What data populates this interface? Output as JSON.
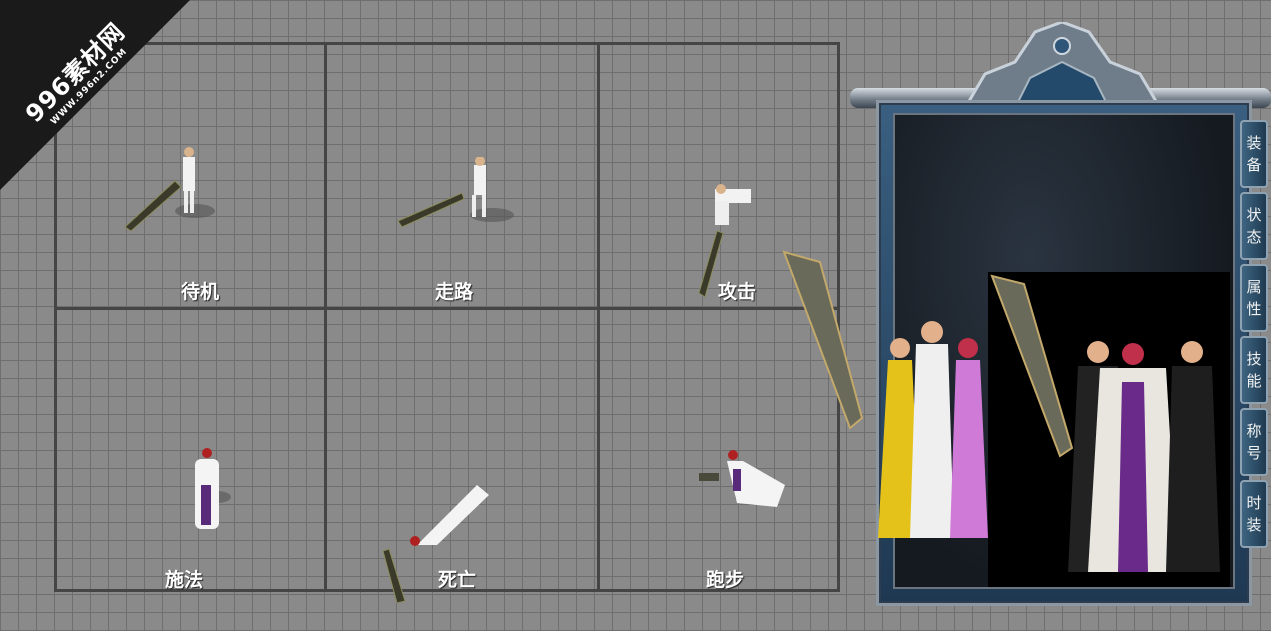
{
  "watermark": {
    "main": "996素材网",
    "url": "WWW.996n2.COM"
  },
  "cells": [
    {
      "label": "待机"
    },
    {
      "label": "走路"
    },
    {
      "label": "攻击"
    },
    {
      "label": "施法"
    },
    {
      "label": "死亡"
    },
    {
      "label": "跑步"
    }
  ],
  "side_tabs": [
    {
      "line1": "装",
      "line2": "备"
    },
    {
      "line1": "状",
      "line2": "态"
    },
    {
      "line1": "属",
      "line2": "性"
    },
    {
      "line1": "技",
      "line2": "能"
    },
    {
      "line1": "称",
      "line2": "号"
    },
    {
      "line1": "时",
      "line2": "装"
    }
  ]
}
